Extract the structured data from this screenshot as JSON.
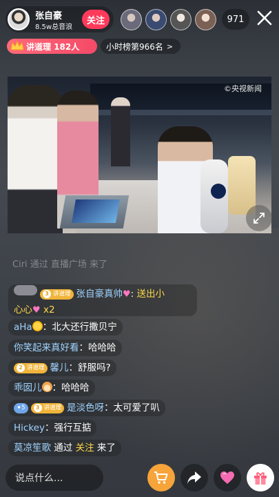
{
  "host": {
    "name": "张自豪",
    "subtitle": "8.5w总音浪",
    "follow_label": "关注"
  },
  "viewers": {
    "count": "971"
  },
  "badges": {
    "rank_label": "讲道理 182人",
    "hour_rank_label": "小时榜第966名"
  },
  "video": {
    "watermark": "©央视新闻"
  },
  "chat": {
    "faded": "Ciri 通过 直播广场 来了",
    "messages": [
      {
        "badge": "3 讲道理",
        "user": "张自豪真帅",
        "text_line1": "送出小",
        "text_line2": "心心",
        "text_suffix": "x2"
      },
      {
        "user": "aHa",
        "text": "北大还行撒贝宁"
      },
      {
        "user": "你笑起来真好看",
        "text": "哈哈哈"
      },
      {
        "badge": "2 讲道理",
        "user": "馨儿",
        "text": "舒服吗?"
      },
      {
        "user": "乖囡儿",
        "text": "哈哈哈"
      },
      {
        "level": "5",
        "badge": "3 讲道理",
        "user": "是淡色呀",
        "text": "太可爱了叭"
      },
      {
        "user": "Hickey",
        "text": "强行互掂"
      },
      {
        "user": "莫凉笙歌",
        "text_pre": "通过",
        "text_link": "关注",
        "text_post": "来了"
      }
    ]
  },
  "input": {
    "placeholder": "说点什么..."
  },
  "colors": {
    "accent": "#fe3a5b",
    "username": "#9fd3ff",
    "gift": "#ffd94a",
    "cart": "#f7a43a"
  }
}
